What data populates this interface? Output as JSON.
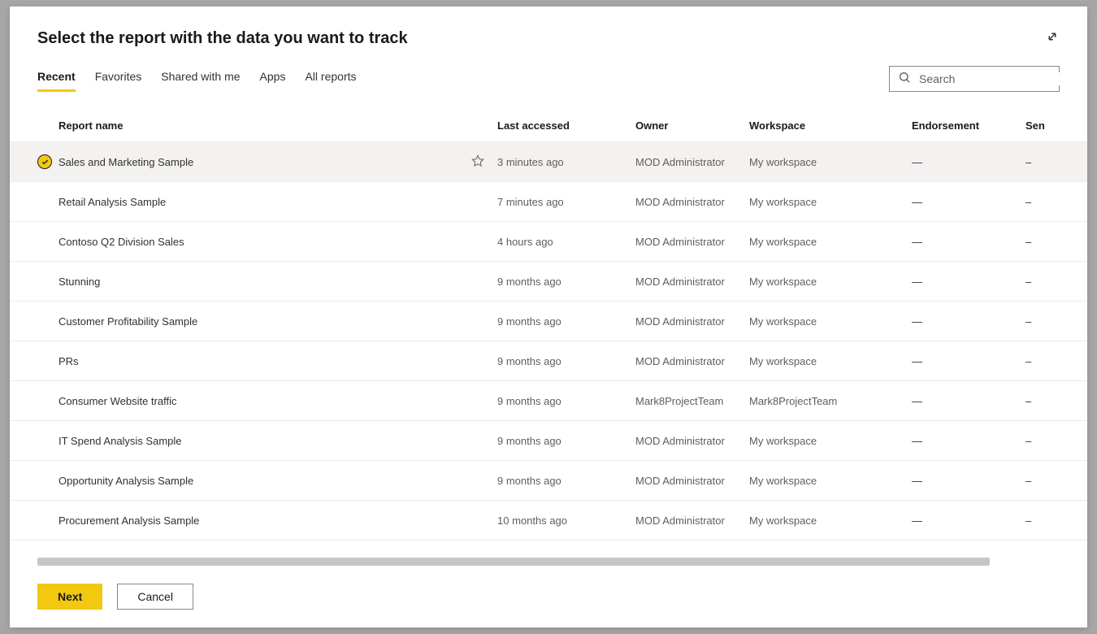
{
  "dialog": {
    "title": "Select the report with the data you want to track"
  },
  "tabs": {
    "items": [
      {
        "label": "Recent",
        "active": true
      },
      {
        "label": "Favorites",
        "active": false
      },
      {
        "label": "Shared with me",
        "active": false
      },
      {
        "label": "Apps",
        "active": false
      },
      {
        "label": "All reports",
        "active": false
      }
    ]
  },
  "search": {
    "placeholder": "Search"
  },
  "table": {
    "headers": {
      "report_name": "Report name",
      "last_accessed": "Last accessed",
      "owner": "Owner",
      "workspace": "Workspace",
      "endorsement": "Endorsement",
      "sensitivity": "Sen"
    },
    "rows": [
      {
        "name": "Sales and Marketing Sample",
        "last_accessed": "3 minutes ago",
        "owner": "MOD Administrator",
        "workspace": "My workspace",
        "endorsement": "—",
        "sensitivity": "–",
        "selected": true,
        "show_star": true
      },
      {
        "name": "Retail Analysis Sample",
        "last_accessed": "7 minutes ago",
        "owner": "MOD Administrator",
        "workspace": "My workspace",
        "endorsement": "—",
        "sensitivity": "–",
        "selected": false,
        "show_star": false
      },
      {
        "name": "Contoso Q2 Division Sales",
        "last_accessed": "4 hours ago",
        "owner": "MOD Administrator",
        "workspace": "My workspace",
        "endorsement": "—",
        "sensitivity": "–",
        "selected": false,
        "show_star": false
      },
      {
        "name": "Stunning",
        "last_accessed": "9 months ago",
        "owner": "MOD Administrator",
        "workspace": "My workspace",
        "endorsement": "—",
        "sensitivity": "–",
        "selected": false,
        "show_star": false
      },
      {
        "name": "Customer Profitability Sample",
        "last_accessed": "9 months ago",
        "owner": "MOD Administrator",
        "workspace": "My workspace",
        "endorsement": "—",
        "sensitivity": "–",
        "selected": false,
        "show_star": false
      },
      {
        "name": "PRs",
        "last_accessed": "9 months ago",
        "owner": "MOD Administrator",
        "workspace": "My workspace",
        "endorsement": "—",
        "sensitivity": "–",
        "selected": false,
        "show_star": false
      },
      {
        "name": "Consumer Website traffic",
        "last_accessed": "9 months ago",
        "owner": "Mark8ProjectTeam",
        "workspace": "Mark8ProjectTeam",
        "endorsement": "—",
        "sensitivity": "–",
        "selected": false,
        "show_star": false
      },
      {
        "name": "IT Spend Analysis Sample",
        "last_accessed": "9 months ago",
        "owner": "MOD Administrator",
        "workspace": "My workspace",
        "endorsement": "—",
        "sensitivity": "–",
        "selected": false,
        "show_star": false
      },
      {
        "name": "Opportunity Analysis Sample",
        "last_accessed": "9 months ago",
        "owner": "MOD Administrator",
        "workspace": "My workspace",
        "endorsement": "—",
        "sensitivity": "–",
        "selected": false,
        "show_star": false
      },
      {
        "name": "Procurement Analysis Sample",
        "last_accessed": "10 months ago",
        "owner": "MOD Administrator",
        "workspace": "My workspace",
        "endorsement": "—",
        "sensitivity": "–",
        "selected": false,
        "show_star": false
      }
    ]
  },
  "footer": {
    "next": "Next",
    "cancel": "Cancel"
  }
}
